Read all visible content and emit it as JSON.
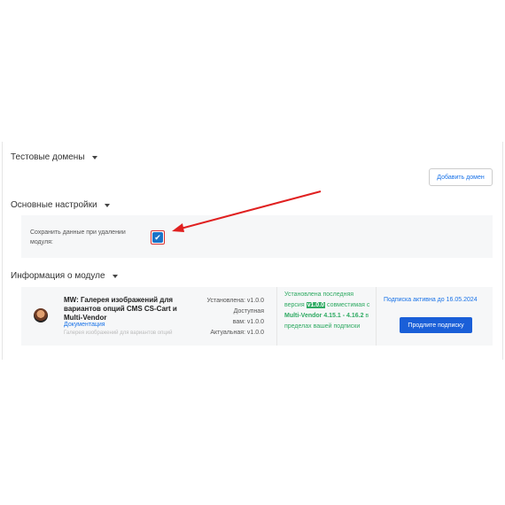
{
  "sections": {
    "test_domains": {
      "title": "Тестовые домены",
      "add_button": "Добавить домен"
    },
    "main_settings": {
      "title": "Основные настройки",
      "option_label": "Сохранить данные при удалении модуля:",
      "option_checked": true
    },
    "module_info": {
      "title": "Информация о модуле",
      "module_name": "MW: Галерея изображений для вариантов опций CMS CS-Cart и Multi-Vendor",
      "doc_link": "Документация",
      "description": "Галерея изображений для вариантов опций",
      "installed": "Установлена: v1.0.0",
      "available_1": "Доступная",
      "available_2": "вам: v1.0.0",
      "actual": "Актуальная: v1.0.0",
      "latest_prefix": "Установлена последняя версия ",
      "latest_version": "v1.0.0",
      "latest_compat": " совместимая с ",
      "latest_range": "Multi-Vendor 4.15.1 - 4.16.2",
      "latest_suffix": " в пределах вашей подписки",
      "subscription_status": "Подписка активна до 16.05.2024",
      "extend_button": "Продлите подписку"
    }
  },
  "colors": {
    "accent": "#1a73e8",
    "primary_button": "#1a5fd8",
    "success": "#2eaa62",
    "highlight_frame": "#d93030"
  },
  "icons": {
    "checkbox": "check-icon",
    "caret": "caret-down-icon",
    "avatar": "module-author-avatar"
  }
}
